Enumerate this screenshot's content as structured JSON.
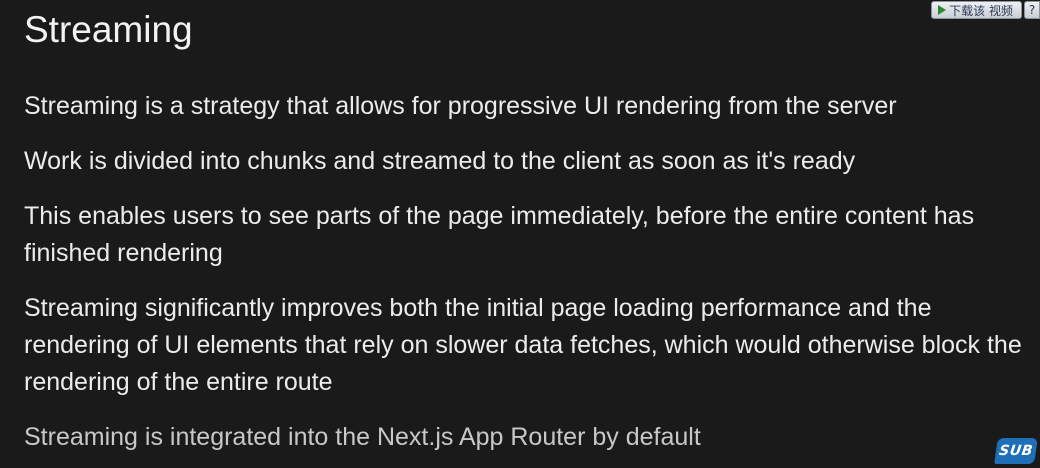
{
  "slide": {
    "title": "Streaming",
    "bullets": [
      "Streaming is a strategy that allows for progressive UI rendering from the server",
      "Work is divided into chunks and streamed to the client as soon as it's ready",
      "This enables users to see parts of the page immediately, before the entire content has finished rendering",
      "Streaming significantly improves both the initial page loading performance and the rendering of UI elements that rely on slower data fetches, which would otherwise block the rendering of the entire route",
      "Streaming is integrated into the Next.js App Router by default"
    ]
  },
  "toolbar": {
    "download_label": "下载该 视频",
    "help_label": "?",
    "download_icon": "play-icon"
  },
  "badge": {
    "label": "SUB"
  },
  "colors": {
    "background": "#1a1a1a",
    "text": "#ececec",
    "badge": "#1f6fb8"
  }
}
